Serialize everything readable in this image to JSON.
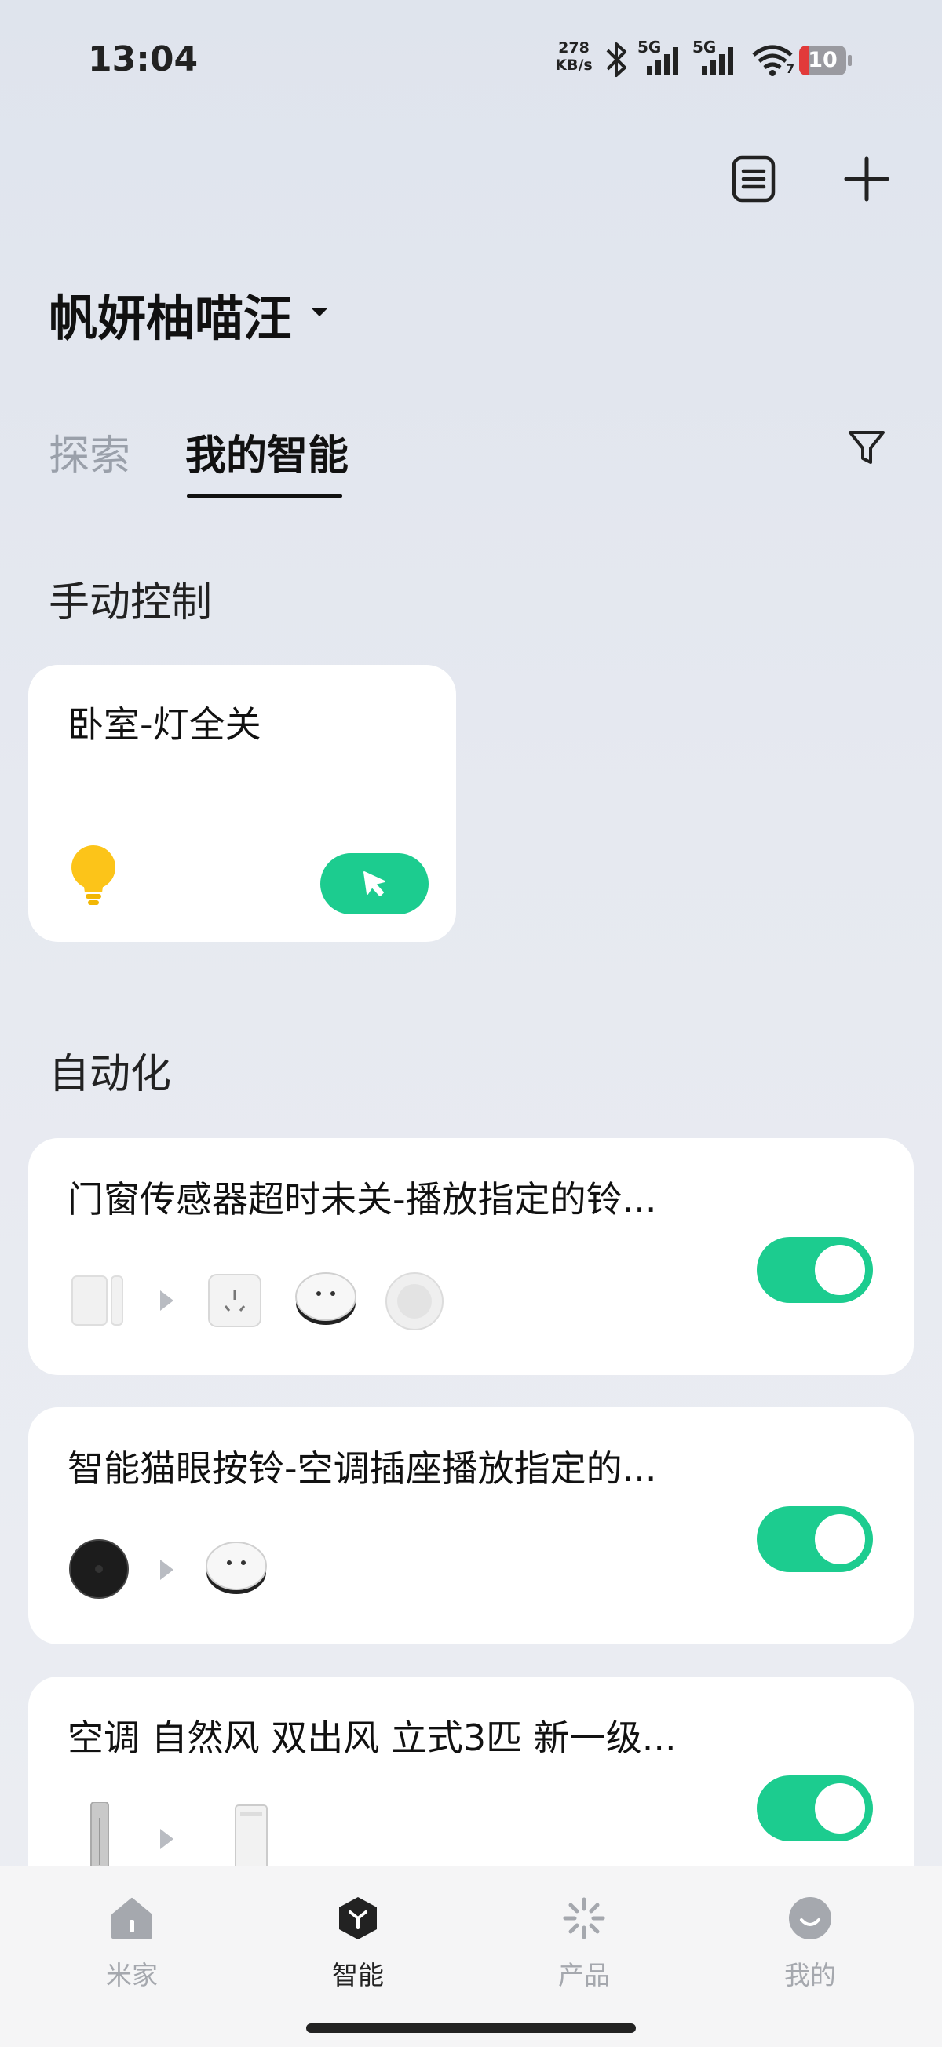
{
  "status_bar": {
    "time": "13:04",
    "net_speed_value": "278",
    "net_speed_unit": "KB/s",
    "sim1": "5G",
    "sim2": "5G",
    "wifi_badge": "7",
    "battery": "10"
  },
  "header": {
    "home_name": "帆妍柚喵汪",
    "icons": [
      "log-icon",
      "plus-icon"
    ]
  },
  "tabs": [
    {
      "label": "探索",
      "active": false
    },
    {
      "label": "我的智能",
      "active": true
    }
  ],
  "manual_section": {
    "title": "手动控制",
    "cards": [
      {
        "name": "卧室-灯全关",
        "icon": "bulb-icon"
      }
    ]
  },
  "automation_section": {
    "title": "自动化",
    "items": [
      {
        "title": "门窗传感器超时未关-播放指定的铃...",
        "enabled": true
      },
      {
        "title": "智能猫眼按铃-空调插座播放指定的...",
        "enabled": true
      },
      {
        "title": "空调 自然风 双出风 立式3匹 新一级...",
        "enabled": true
      }
    ]
  },
  "bottom_nav": [
    {
      "label": "米家",
      "icon": "home-icon",
      "active": false
    },
    {
      "label": "智能",
      "icon": "smart-icon",
      "active": true
    },
    {
      "label": "产品",
      "icon": "product-icon",
      "active": false
    },
    {
      "label": "我的",
      "icon": "profile-icon",
      "active": false
    }
  ],
  "colors": {
    "accent": "#1ccc8f",
    "background": "#e6e9f0",
    "card": "#ffffff"
  }
}
